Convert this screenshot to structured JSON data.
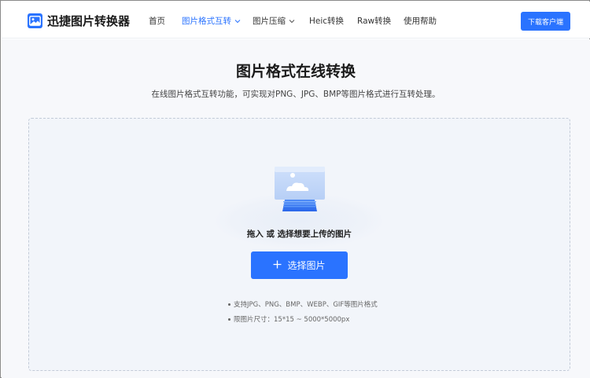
{
  "header": {
    "logo_text": "迅捷图片转换器",
    "nav": [
      {
        "label": "首页"
      },
      {
        "label": "图片格式互转",
        "active": true
      },
      {
        "label": "图片压缩"
      },
      {
        "label": "Heic转换"
      },
      {
        "label": "Raw转换"
      },
      {
        "label": "使用帮助"
      }
    ],
    "download_label": "下载客户端"
  },
  "main": {
    "title": "图片格式在线转换",
    "subtitle": "在线图片格式互转功能，可实现对PNG、JPG、BMP等图片格式进行互转处理。",
    "dropzone": {
      "hint": "拖入 或 选择想要上传的图片",
      "select_label": "选择图片",
      "notes": [
        "支持JPG、PNG、BMP、WEBP、GIF等图片格式",
        "限图片尺寸：15*15 ~ 5000*5000px"
      ]
    }
  },
  "colors": {
    "accent": "#2a73ff",
    "background": "#f7f8fb",
    "dropzone_bg": "#f2f5fa"
  },
  "icons": {
    "logo": "image-convert-icon",
    "dropdown": "chevron-down-icon",
    "add": "plus-icon",
    "upload_illustration": "image-upload-illustration"
  }
}
